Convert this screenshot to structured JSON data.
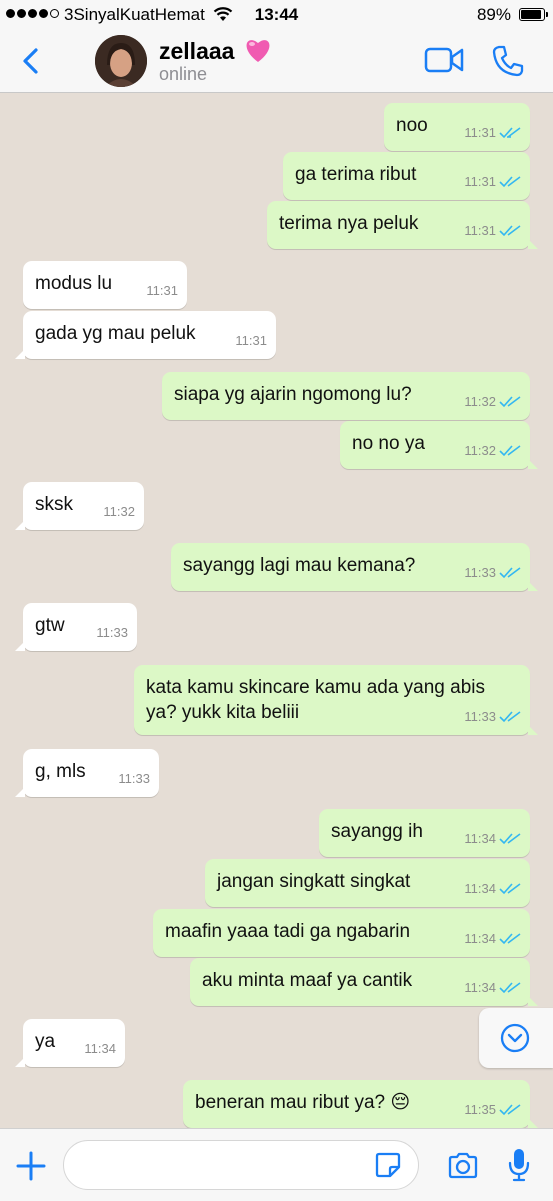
{
  "status_bar": {
    "carrier": "3SinyalKuatHemat",
    "time": "13:44",
    "battery": "89%",
    "battery_level": 0.89,
    "signal_bars": 4
  },
  "header": {
    "back_icon": "chevron-left-icon",
    "name": "zellaaa",
    "emoji": "pink-heart",
    "status": "online",
    "accent_color": "#1a7ef5"
  },
  "messages": [
    {
      "text": "noo",
      "time": "11:31",
      "dir": "out"
    },
    {
      "text": "ga terima ribut",
      "time": "11:31",
      "dir": "out"
    },
    {
      "text": "terima nya peluk",
      "time": "11:31",
      "dir": "out"
    },
    {
      "text": "modus lu",
      "time": "11:31",
      "dir": "in"
    },
    {
      "text": "gada yg mau peluk",
      "time": "11:31",
      "dir": "in"
    },
    {
      "text": "siapa yg ajarin ngomong lu?",
      "time": "11:32",
      "dir": "out"
    },
    {
      "text": "no no ya",
      "time": "11:32",
      "dir": "out"
    },
    {
      "text": "sksk",
      "time": "11:32",
      "dir": "in"
    },
    {
      "text": "sayangg lagi mau kemana?",
      "time": "11:33",
      "dir": "out"
    },
    {
      "text": "gtw",
      "time": "11:33",
      "dir": "in"
    },
    {
      "text": "kata kamu skincare kamu ada yang abis ya? yukk kita beliii",
      "time": "11:33",
      "dir": "out"
    },
    {
      "text": "g, mls",
      "time": "11:33",
      "dir": "in"
    },
    {
      "text": "sayangg ih",
      "time": "11:34",
      "dir": "out"
    },
    {
      "text": "jangan singkatt singkat",
      "time": "11:34",
      "dir": "out"
    },
    {
      "text": "maafin yaaa tadi ga ngabarin",
      "time": "11:34",
      "dir": "out"
    },
    {
      "text": "aku minta maaf ya cantik",
      "time": "11:34",
      "dir": "out"
    },
    {
      "text": "ya",
      "time": "11:34",
      "dir": "in"
    },
    {
      "text": "beneran mau ribut ya? 😔",
      "time": "11:35",
      "dir": "out"
    }
  ],
  "colors": {
    "outgoing_bubble": "#dcf8c6",
    "incoming_bubble": "#ffffff",
    "read_ticks": "#34b7f1",
    "chat_background": "#e5ddd5"
  },
  "input": {
    "placeholder": "",
    "icons": [
      "plus-icon",
      "sticker-icon",
      "camera-icon",
      "microphone-icon"
    ]
  }
}
